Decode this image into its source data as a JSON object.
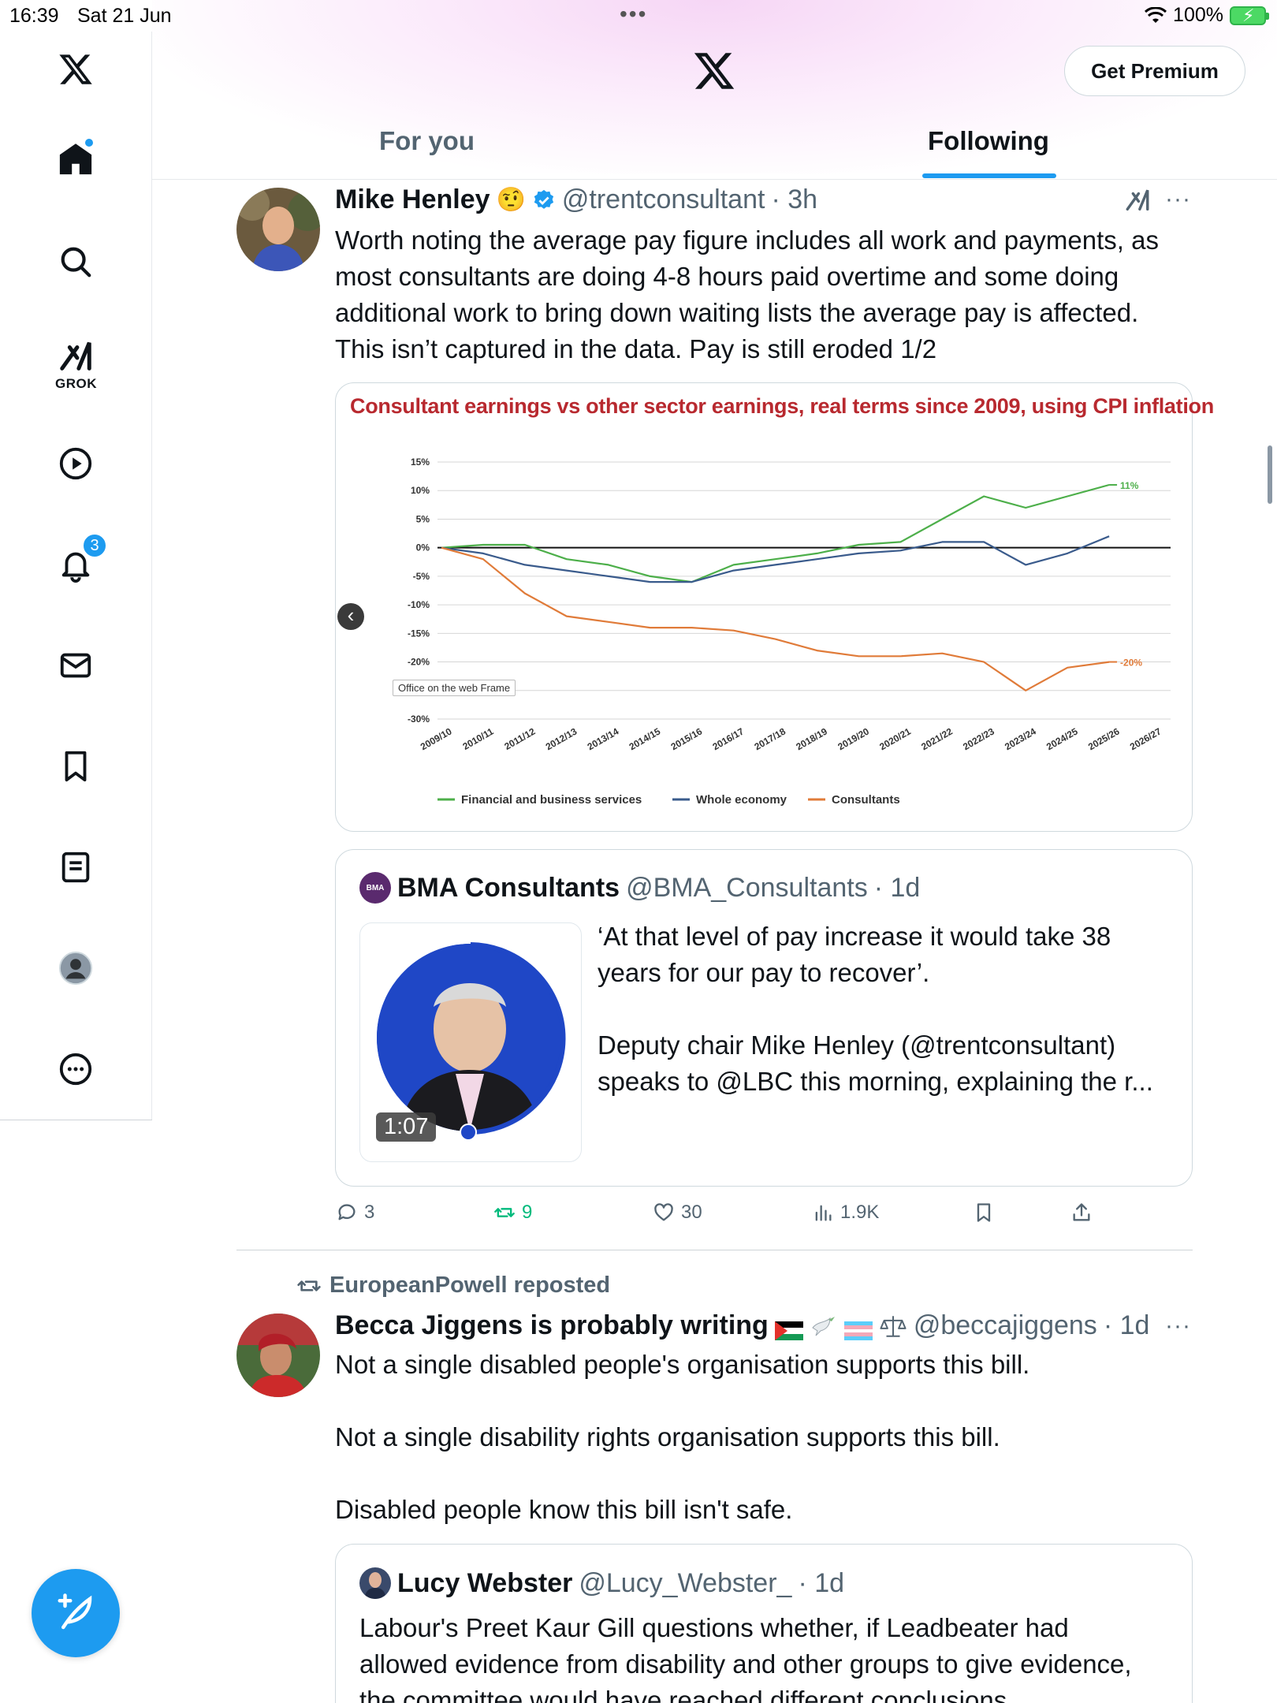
{
  "status_bar": {
    "time": "16:39",
    "date": "Sat 21 Jun",
    "battery": "100%"
  },
  "sidebar": {
    "items": [
      {
        "icon": "x-logo-icon"
      },
      {
        "icon": "home-icon"
      },
      {
        "icon": "search-icon"
      },
      {
        "icon": "grok-icon",
        "label": "GROK"
      },
      {
        "icon": "video-play-icon"
      },
      {
        "icon": "bell-icon",
        "badge": "3"
      },
      {
        "icon": "mail-icon"
      },
      {
        "icon": "bookmark-icon"
      },
      {
        "icon": "list-icon"
      },
      {
        "icon": "profile-icon"
      },
      {
        "icon": "more-circle-icon"
      }
    ],
    "compose_icon": "compose-feather-icon"
  },
  "header": {
    "premium_label": "Get Premium",
    "tabs": [
      {
        "label": "For you",
        "active": false
      },
      {
        "label": "Following",
        "active": true
      }
    ]
  },
  "tweet1": {
    "name": "Mike Henley",
    "emoji": "🤨",
    "handle": "@trentconsultant",
    "time": "· 3h",
    "text": "Worth noting the average pay figure includes all work and payments, as\nmost consultants are doing 4-8 hours paid overtime and some doing\nadditional work to bring down waiting lists the average pay is affected.\nThis isn’t captured in the data. Pay is still eroded 1/2",
    "office_tooltip": "Office on the web Frame",
    "quote": {
      "name": "BMA Consultants",
      "logo_text": "BMA",
      "handle": "@BMA_Consultants",
      "time": "· 1d",
      "text": "‘At that level of pay increase it would take 38\nyears for our pay to recover’.\n\nDeputy chair Mike Henley (@trentconsultant)\nspeaks to @LBC this morning, explaining the r...",
      "video_duration": "1:07"
    },
    "actions": {
      "replies": "3",
      "reposts": "9",
      "likes": "30",
      "views": "1.9K"
    }
  },
  "tweet2": {
    "repost_by": "EuropeanPowell reposted",
    "name": "Becca Jiggens is probably writing",
    "handle": "@beccajiggens",
    "time": "· 1d",
    "text": "Not a single disabled people's organisation supports this bill.\n\nNot a single disability rights organisation supports this bill.\n\nDisabled people know this bill isn't safe.",
    "quote": {
      "name": "Lucy Webster",
      "handle": "@Lucy_Webster_",
      "time": "· 1d",
      "text": "Labour's Preet Kaur Gill questions whether, if Leadbeater had\nallowed evidence from disability and other groups to give evidence,\nthe committee would have reached different conclusions."
    }
  },
  "chart_data": {
    "type": "line",
    "title": "Consultant earnings vs other sector earnings, real terms since 2009, using CPI inflation",
    "categories": [
      "2009/10",
      "2010/11",
      "2011/12",
      "2012/13",
      "2013/14",
      "2014/15",
      "2015/16",
      "2016/17",
      "2017/18",
      "2018/19",
      "2019/20",
      "2020/21",
      "2021/22",
      "2022/23",
      "2023/24",
      "2024/25",
      "2025/26",
      "2026/27"
    ],
    "y_ticks": [
      "15%",
      "10%",
      "5%",
      "0%",
      "-5%",
      "-10%",
      "-15%",
      "-20%",
      "-25%",
      "-30%"
    ],
    "ylim": [
      -30,
      15
    ],
    "series": [
      {
        "name": "Financial and business services",
        "color": "#4daf4a",
        "values": [
          0,
          0.5,
          0.5,
          -2,
          -3,
          -5,
          -6,
          -3,
          -2,
          -1,
          0.5,
          1,
          5,
          9,
          7,
          9,
          11,
          null
        ],
        "end_label": "11%"
      },
      {
        "name": "Whole economy",
        "color": "#3a5b8c",
        "values": [
          0,
          -1,
          -3,
          -4,
          -5,
          -6,
          -6,
          -4,
          -3,
          -2,
          -1,
          -0.5,
          1,
          1,
          -3,
          -1,
          2,
          null
        ]
      },
      {
        "name": "Consultants",
        "color": "#e07b39",
        "values": [
          0,
          -2,
          -8,
          -12,
          -13,
          -14,
          -14,
          -14.5,
          -16,
          -18,
          -19,
          -19,
          -18.5,
          -20,
          -25,
          -21,
          -20,
          null
        ],
        "end_label": "-20%"
      }
    ],
    "legend_position": "bottom"
  }
}
